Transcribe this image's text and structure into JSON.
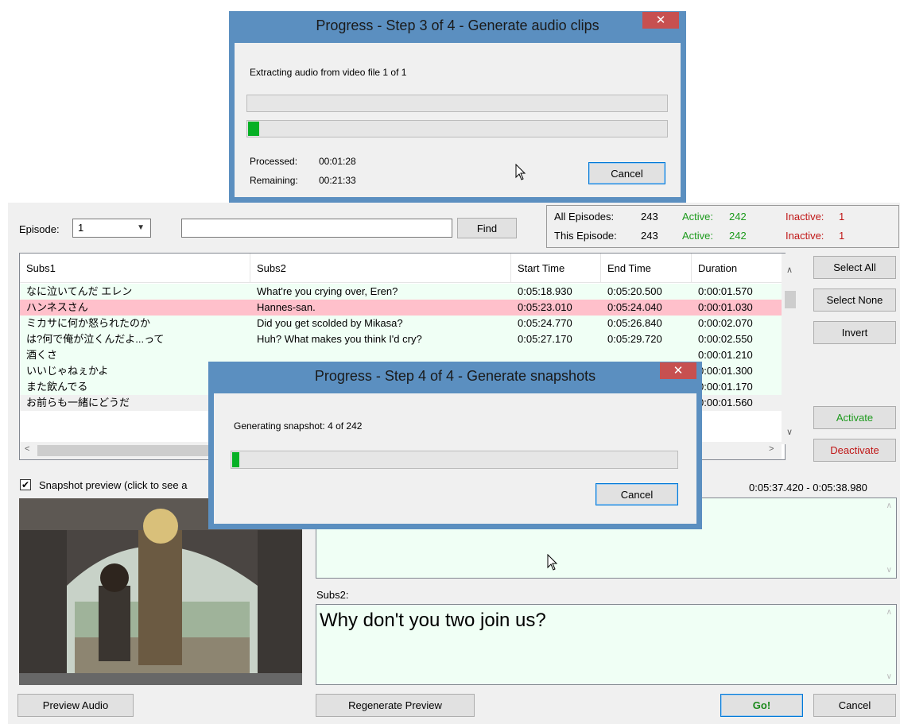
{
  "top_dialog": {
    "title": "Progress - Step 3 of 4 - Generate audio clips",
    "message": "Extracting audio from video file 1 of 1",
    "progress_1": 0,
    "progress_2": 0.03,
    "processed_label": "Processed:",
    "processed_value": "00:01:28",
    "remaining_label": "Remaining:",
    "remaining_value": "00:21:33",
    "cancel_label": "Cancel",
    "close_glyph": "✕"
  },
  "toolbar": {
    "episode_label": "Episode:",
    "episode_value": "1",
    "search_value": "",
    "find_label": "Find"
  },
  "stats": {
    "all_label": "All Episodes:",
    "all_value": "243",
    "this_label": "This Episode:",
    "this_value": "243",
    "active_label": "Active:",
    "active_all": "242",
    "active_this": "242",
    "inactive_label": "Inactive:",
    "inactive_all": "1",
    "inactive_this": "1"
  },
  "table": {
    "columns": [
      "Subs1",
      "Subs2",
      "Start Time",
      "End Time",
      "Duration"
    ],
    "rows": [
      {
        "subs1": "なに泣いてんだ エレン",
        "subs2": "What're you crying over, Eren?",
        "start": "0:05:18.930",
        "end": "0:05:20.500",
        "dur": "0:00:01.570"
      },
      {
        "subs1": "ハンネスさん",
        "subs2": "Hannes-san.",
        "start": "0:05:23.010",
        "end": "0:05:24.040",
        "dur": "0:00:01.030"
      },
      {
        "subs1": "ミカサに何か怒られたのか",
        "subs2": "Did you get scolded by Mikasa?",
        "start": "0:05:24.770",
        "end": "0:05:26.840",
        "dur": "0:00:02.070"
      },
      {
        "subs1": "は?何で俺が泣くんだよ...って",
        "subs2": "Huh? What makes you think I'd cry?",
        "start": "0:05:27.170",
        "end": "0:05:29.720",
        "dur": "0:00:02.550"
      },
      {
        "subs1": "酒くさ",
        "subs2": "",
        "start": "",
        "end": "",
        "dur": "0:00:01.210"
      },
      {
        "subs1": "いいじゃねぇかよ",
        "subs2": "",
        "start": "",
        "end": "",
        "dur": "0:00:01.300"
      },
      {
        "subs1": "また飲んでる",
        "subs2": "",
        "start": "",
        "end": "",
        "dur": "0:00:01.170"
      },
      {
        "subs1": "お前らも一緒にどうだ",
        "subs2": "",
        "start": "",
        "end": "",
        "dur": "0:00:01.560"
      }
    ]
  },
  "side_buttons": {
    "select_all": "Select All",
    "select_none": "Select None",
    "invert": "Invert",
    "activate": "Activate",
    "deactivate": "Deactivate"
  },
  "preview": {
    "checkbox_label": "Snapshot preview (click to see a",
    "checked_glyph": "✔",
    "time_range": "0:05:37.420  -  0:05:38.980",
    "subs1_text": "",
    "subs2_label": "Subs2:",
    "subs2_text": "Why don't you two join us?"
  },
  "bottom": {
    "preview_audio": "Preview Audio",
    "regenerate": "Regenerate Preview",
    "go": "Go!",
    "cancel": "Cancel"
  },
  "mid_dialog": {
    "title": "Progress - Step 4 of 4 - Generate snapshots",
    "message": "Generating snapshot: 4 of 242",
    "progress": 0.02,
    "cancel_label": "Cancel",
    "close_glyph": "✕"
  },
  "scroll": {
    "up": "∧",
    "down": "∨",
    "left": "<",
    "right": ">"
  },
  "colors": {
    "accent_frame": "#5b8fc0",
    "row_alt": "#f0fff5",
    "row_selected": "#ffc0cb",
    "progress_fill": "#06b025",
    "close_button": "#c75050",
    "active_text": "#1c9a1c",
    "inactive_text": "#c01616"
  }
}
